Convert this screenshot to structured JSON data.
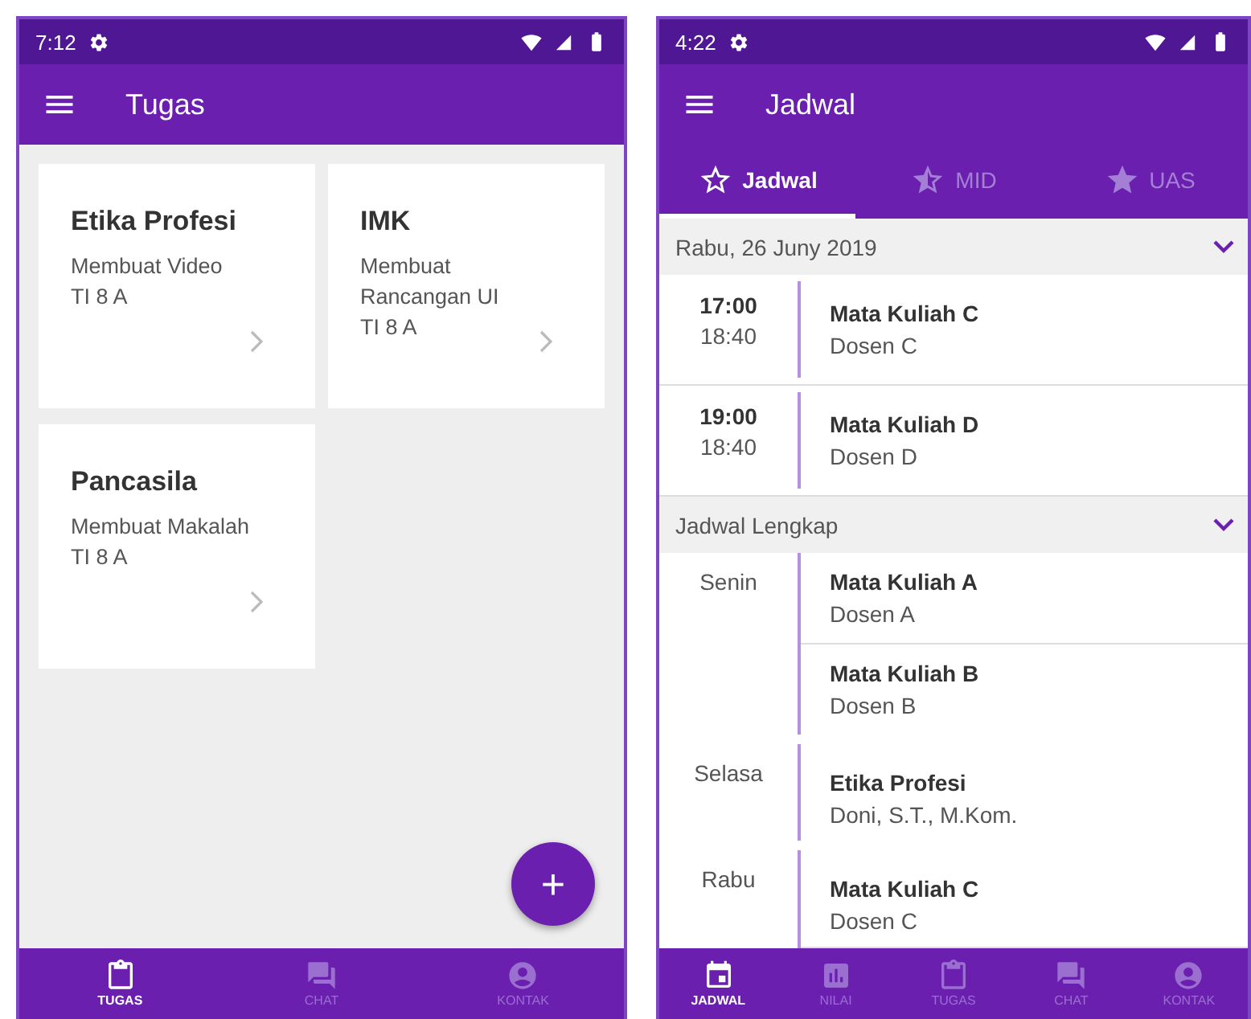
{
  "tugas_screen": {
    "status_bar": {
      "time": "7:12"
    },
    "app_bar": {
      "title": "Tugas"
    },
    "cards": [
      {
        "title": "Etika Profesi",
        "task": "Membuat Video",
        "class": "TI 8 A"
      },
      {
        "title": "IMK",
        "task": "Membuat Rancangan UI",
        "class": "TI 8 A"
      },
      {
        "title": "Pancasila",
        "task": "Membuat Makalah",
        "class": "TI 8 A"
      }
    ],
    "fab": "+",
    "bottom_nav": [
      {
        "kind": "tasks",
        "label": "TUGAS",
        "selected": true
      },
      {
        "kind": "chat",
        "label": "CHAT",
        "selected": false
      },
      {
        "kind": "contact",
        "label": "KONTAK",
        "selected": false
      }
    ]
  },
  "jadwal_screen": {
    "status_bar": {
      "time": "4:22"
    },
    "app_bar": {
      "title": "Jadwal"
    },
    "tabs": [
      {
        "kind": "outline",
        "label": "Jadwal",
        "selected": true
      },
      {
        "kind": "half",
        "label": "MID",
        "selected": false
      },
      {
        "kind": "full",
        "label": "UAS",
        "selected": false
      }
    ],
    "today": {
      "header": "Rabu, 26 Juny 2019",
      "items": [
        {
          "start": "17:00",
          "end": "18:40",
          "course": "Mata Kuliah C",
          "lecturer": "Dosen C"
        },
        {
          "start": "19:00",
          "end": "18:40",
          "course": "Mata Kuliah D",
          "lecturer": "Dosen D"
        }
      ]
    },
    "full": {
      "header": "Jadwal Lengkap",
      "days": [
        {
          "day": "Senin",
          "entries": [
            {
              "course": "Mata Kuliah A",
              "lecturer": "Dosen A"
            },
            {
              "course": "Mata Kuliah B",
              "lecturer": "Dosen B"
            }
          ]
        },
        {
          "day": "Selasa",
          "entries": [
            {
              "course": "Etika Profesi",
              "lecturer": "Doni, S.T., M.Kom."
            }
          ]
        },
        {
          "day": "Rabu",
          "entries": [
            {
              "course": "Mata Kuliah C",
              "lecturer": "Dosen C"
            }
          ]
        }
      ]
    },
    "bottom_nav": [
      {
        "kind": "schedule",
        "label": "JADWAL",
        "selected": true
      },
      {
        "kind": "grades",
        "label": "NILAI",
        "selected": false
      },
      {
        "kind": "tasks",
        "label": "TUGAS",
        "selected": false
      },
      {
        "kind": "chat",
        "label": "CHAT",
        "selected": false
      },
      {
        "kind": "contact",
        "label": "KONTAK",
        "selected": false
      }
    ]
  }
}
